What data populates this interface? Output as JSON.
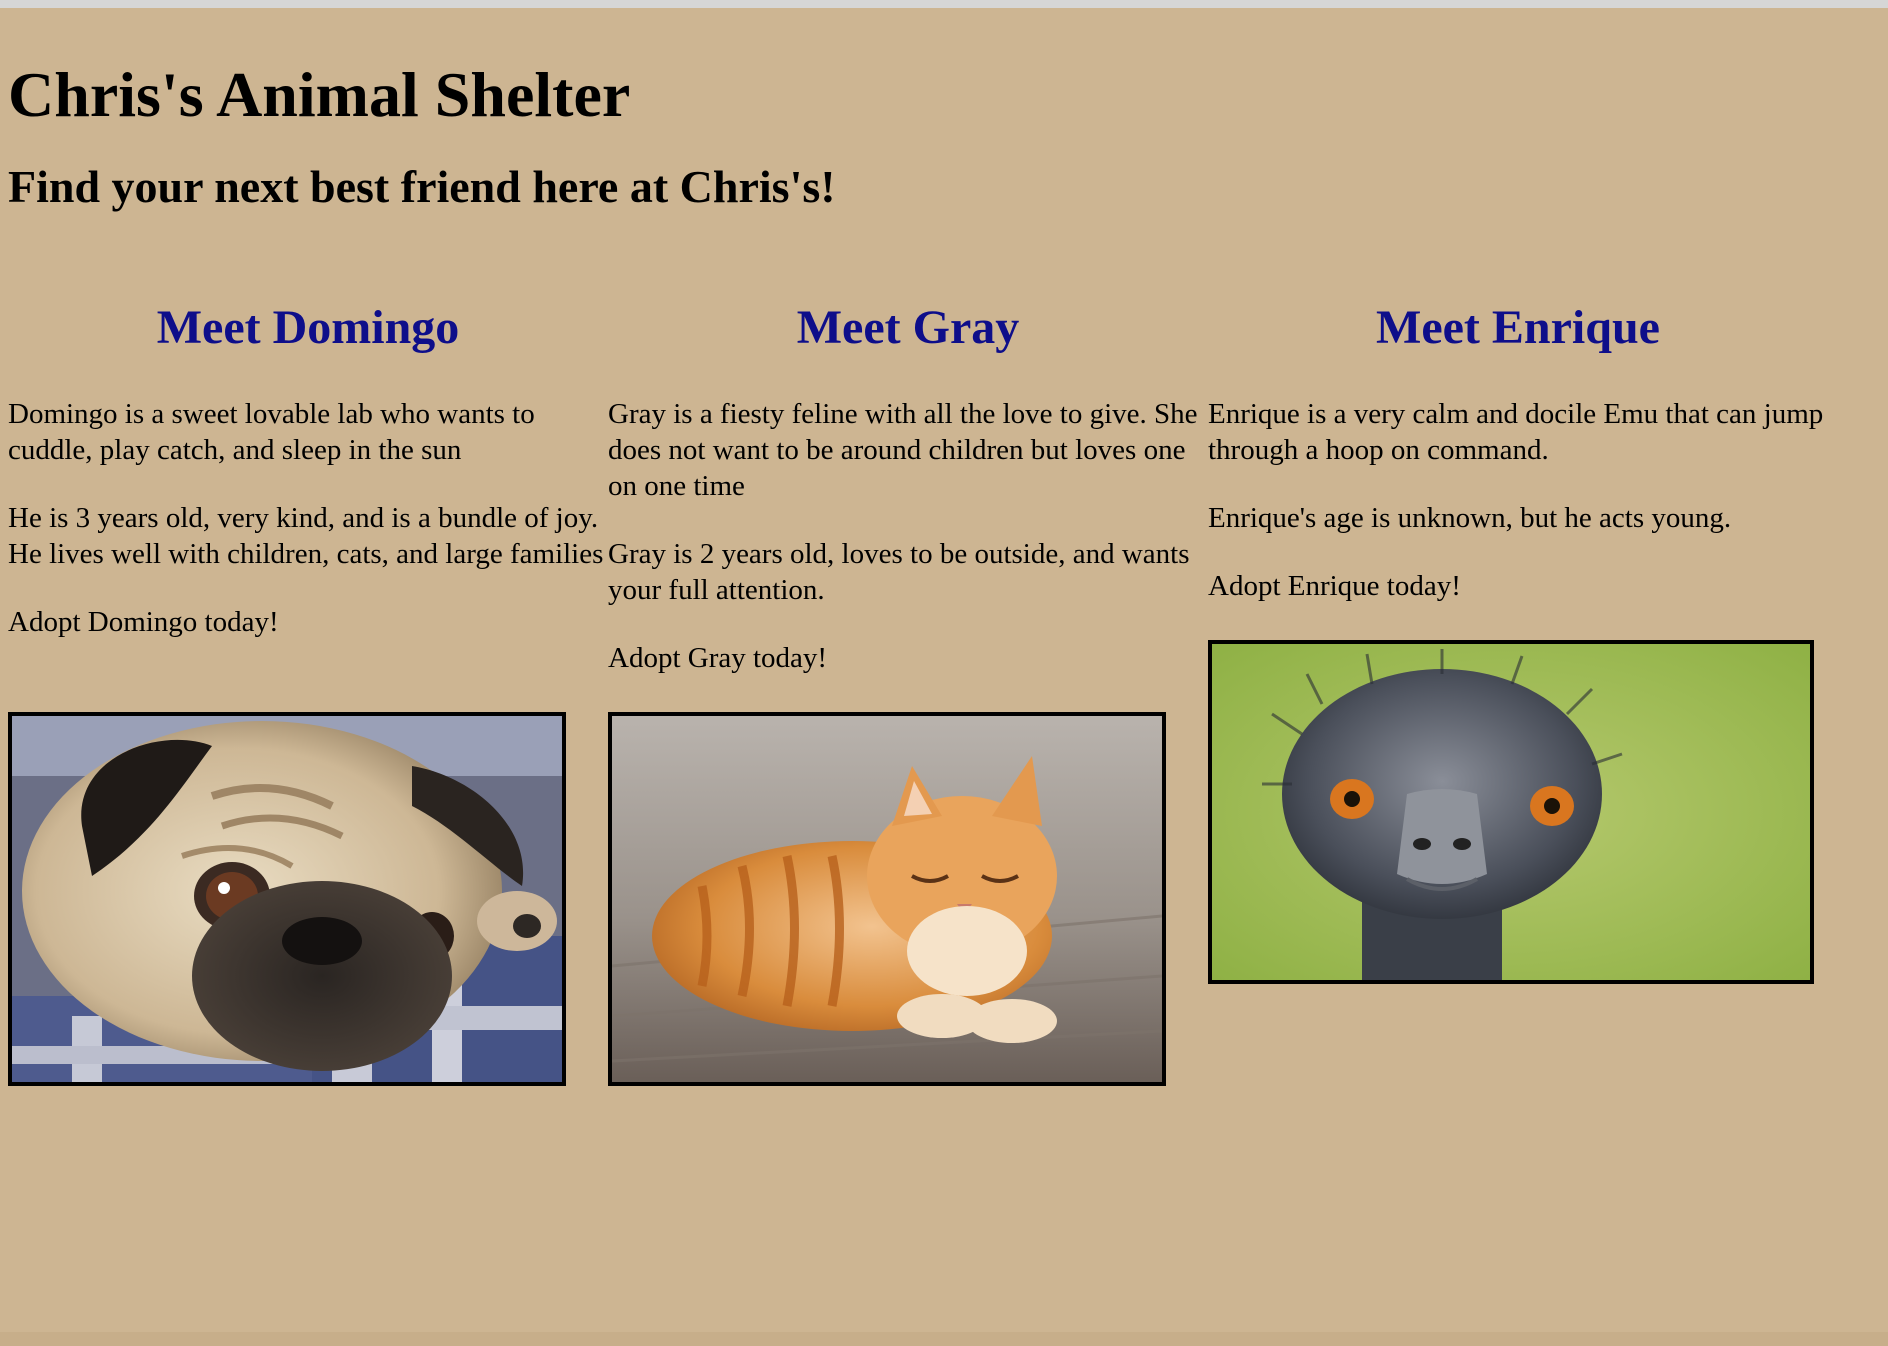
{
  "page": {
    "title": "Chris's Animal Shelter",
    "tagline": "Find your next best friend here at Chris's!"
  },
  "animals": [
    {
      "heading": "Meet Domingo",
      "description": "Domingo is a sweet lovable lab who wants to cuddle, play catch, and sleep in the sun",
      "details": "He is 3 years old, very kind, and is a bundle of joy. He lives well with children, cats, and large families",
      "cta": "Adopt Domingo today!",
      "image": "pug-photo"
    },
    {
      "heading": "Meet Gray",
      "description": "Gray is a fiesty feline with all the love to give. She does not want to be around children but loves one on one time",
      "details": "Gray is 2 years old, loves to be outside, and wants your full attention.",
      "cta": "Adopt Gray today!",
      "image": "orange-cat-photo"
    },
    {
      "heading": "Meet Enrique",
      "description": "Enrique is a very calm and docile Emu that can jump through a hoop on command.",
      "details": "Enrique's age is unknown, but he acts young.",
      "cta": "Adopt Enrique today!",
      "image": "emu-photo"
    }
  ],
  "colors": {
    "background": "#cdb592",
    "heading_blue": "#0e0e8a",
    "text": "#000000"
  }
}
